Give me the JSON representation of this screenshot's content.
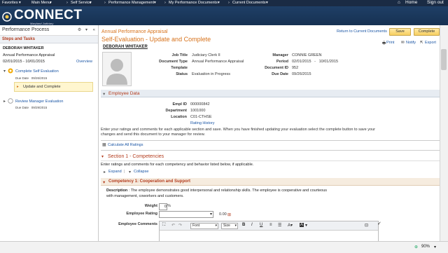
{
  "topnav": {
    "favorites": "Favorites",
    "main_menu": "Main Menu",
    "self_service": "Self Service",
    "performance_management": "Performance Management",
    "my_performance_documents": "My Performance Documents",
    "current_documents": "Current Documents",
    "home": "Home",
    "sign_out": "Sign out"
  },
  "banner": {
    "logo": "CONNECT",
    "subtitle": "Maryland Judiciary"
  },
  "left_panel": {
    "title": "Performance Process",
    "steps_label": "Steps and Tasks",
    "employee": "DEBORAH WHITAKER",
    "appraisal": "Annual Performance Appraisal",
    "period_start": "02/01/2015",
    "period_end": "10/01/2015",
    "overview": "Overview",
    "step1": {
      "label": "Complete Self Evaluation",
      "due_label": "Due Date",
      "due": "09/26/2015",
      "task": "Update and Complete"
    },
    "step2": {
      "label": "Review Manager Evaluation",
      "due_label": "Due Date",
      "due": "09/29/2015"
    }
  },
  "main": {
    "appraisal_title": "Annual Performance Appraisal",
    "return_link": "Return to Current Documents",
    "save": "Save",
    "complete": "Complete",
    "page_title": "Self-Evaluation - Update and Complete",
    "employee_name": "DEBORAH WHITAKER",
    "print": "Print",
    "notify": "Notify",
    "export": "Export",
    "info": {
      "job_title_label": "Job Title",
      "job_title": "Judiciary Clerk II",
      "doc_type_label": "Document Type",
      "doc_type": "Annual Performance Appraisal",
      "template_label": "Template",
      "template": "",
      "status_label": "Status",
      "status": "Evaluation in Progress",
      "manager_label": "Manager",
      "manager": "CONNIE GREEN",
      "period_label": "Period",
      "period_start": "02/01/2015",
      "period_dash": "-",
      "period_end": "10/01/2015",
      "docid_label": "Document ID",
      "docid": "952",
      "due_label": "Due Date",
      "due": "09/26/2015"
    },
    "employee_data": {
      "header": "Employee Data",
      "empl_id_label": "Empl ID",
      "empl_id": "000000842",
      "dept_label": "Department",
      "dept": "1001000",
      "location_label": "Location",
      "location": "C01-CTHSE",
      "rating_history": "Rating History"
    },
    "instructions": "Enter your ratings and comments for each applicable section and save. When you have finished updating your evaluation select the complete button to save your changes and send this document to your manager for review.",
    "calculate": "Calculate All Ratings",
    "section1": {
      "header": "Section 1 - Competencies",
      "instructions": "Enter ratings and comments for each competency and behavior listed below, if applicable.",
      "expand": "Expand",
      "collapse": "Collapse"
    },
    "competency": {
      "header": "Competency 1: Cooperation and Support",
      "desc_label": "Description",
      "description": ": The employee demonstrates good interpersonal and relationship skills. The employee is cooperative and courteous with management, coworkers and customers.",
      "weight_label": "Weight",
      "weight": "0",
      "weight_unit": "%",
      "rating_label": "Employee Rating",
      "rating_value": "0.00",
      "comments_label": "Employee Comments",
      "font_label": "Font",
      "size_label": "Size"
    }
  },
  "statusbar": {
    "zoom": "90%"
  },
  "colors": {
    "nav": "#1a2b44",
    "banner": "#1f3f66",
    "accent": "#d7721b",
    "link": "#1b56a5",
    "section": "#b33b1c"
  }
}
